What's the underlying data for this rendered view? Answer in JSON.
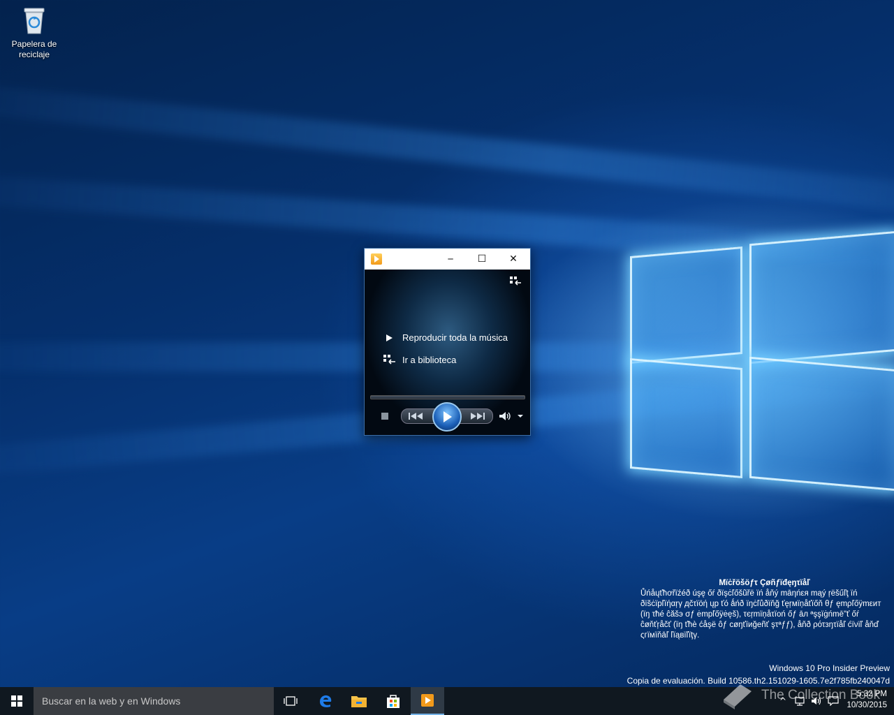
{
  "desktop": {
    "recycle_bin_label": "Papelera de reciclaje"
  },
  "media_player": {
    "window_buttons": {
      "minimize": "─",
      "maximize": "☐",
      "close": "✕"
    },
    "menu": [
      {
        "label": "Reproducir toda la música",
        "icon": "play-icon"
      },
      {
        "label": "Ir a biblioteca",
        "icon": "library-icon"
      }
    ]
  },
  "watermark": {
    "title": "Mïċřöšöƒτ Çøñƒïđęŋτïåľ",
    "body": "Ůńåųťħơřïźéð úşę őŕ ðïşċľőšũřë ïń åňý māηńεя mąý ŗëšűľţ ïń ðïšċïpľïήαŗγ дčτïöή ųp ťó ǻńð ïŋċľůðïňğ ťęŗмïņåťïőň θƒ ęmρľőÿmεит (ïŋ τħé ĉăšэ σƒ ėmpľőÿėęš), τєŗmïņåτïоń őƒ āл ªşşïġńmē\"ť őŕ ĉøňťŗåčť (ïŋ ťħè ćåşë ôƒ сøŋťïиğеñť şτªƒƒ), åňð ρότзŋτïåľ ćïνïľ åňď ςгïмïňāľ ľïąвïľïţγ."
  },
  "edition": {
    "line1": "Windows 10 Pro Insider Preview",
    "line2": "Copia de evaluación. Build 10586.th2.151029-1605.7e2f785fb240047d"
  },
  "taskbar": {
    "search_placeholder": "Buscar en la web y en Windows",
    "clock_time": "5:32 PM",
    "clock_date": "10/30/2015"
  },
  "overlay": {
    "brand": "The Collection Book"
  }
}
